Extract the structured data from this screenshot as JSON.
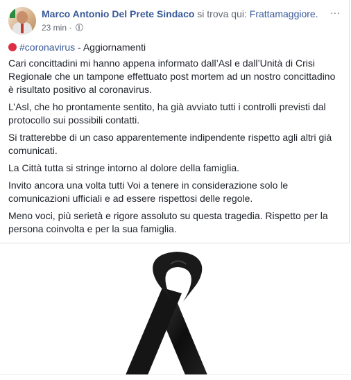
{
  "post": {
    "author": "Marco Antonio Del Prete Sindaco",
    "checkin_prefix": "si trova qui:",
    "place": "Frattamaggiore.",
    "time": "23 min",
    "dot_separator": "·",
    "menu_icon": "···",
    "hashtag": "#coronavirus",
    "tag_suffix": " - Aggiornamenti",
    "paragraphs": [
      "Cari concittadini mi hanno appena informato dall’Asl e dall’Unità di Crisi Regionale che un tampone effettuato post mortem ad un nostro concittadino è risultato positivo al coronavirus.",
      "L’Asl, che ho prontamente sentito, ha già avviato tutti i controlli previsti dal protocollo sui possibili contatti.",
      "Si tratterebbe di un caso apparentemente indipendente rispetto agli altri già comunicati.",
      "La Città tutta si stringe intorno al dolore della famiglia.",
      "Invito ancora una volta tutti Voi a tenere in considerazione solo le comunicazioni ufficiali e ad essere rispettosi delle regole.",
      "Meno voci, più serietà e rigore assoluto su questa tragedia. Rispetto per la persona coinvolta e per la sua famiglia."
    ]
  },
  "colors": {
    "link": "#385898",
    "text": "#1d2129",
    "meta": "#616770",
    "ribbon": "#111111"
  }
}
